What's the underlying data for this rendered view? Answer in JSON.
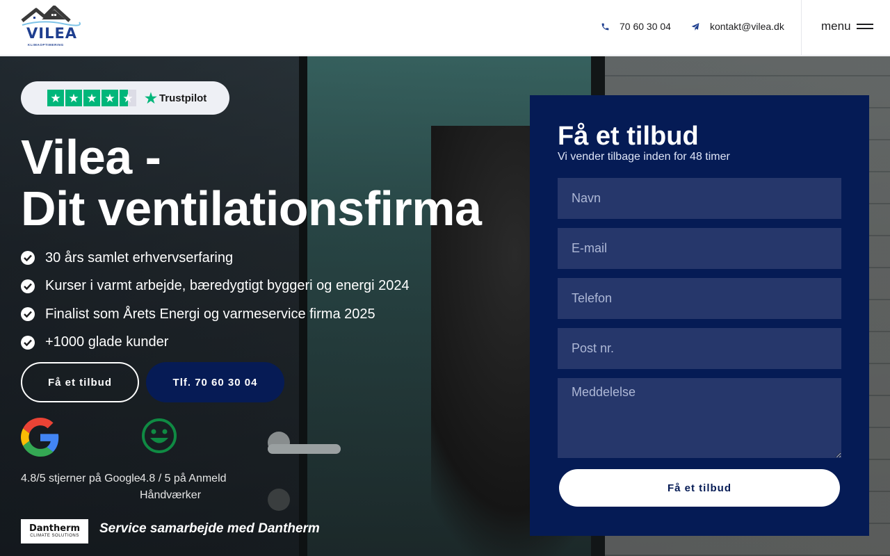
{
  "header": {
    "logo_text": "VILEA",
    "logo_sub": "KLIMAOPTIMERING",
    "phone": "70 60 30 04",
    "email": "kontakt@vilea.dk",
    "menu_label": "menu"
  },
  "hero": {
    "trustpilot": {
      "brand": "Trustpilot",
      "stars": 4.5,
      "star_color": "#00b67a"
    },
    "title_line1": "Vilea -",
    "title_line2": "Dit ventilationsfirma",
    "features": [
      "30 års samlet erhvervserfaring",
      "Kurser i varmt arbejde, bæredygtigt byggeri og energi 2024",
      "Finalist som Årets Energi og varmeservice firma 2025",
      "+1000 glade kunder"
    ],
    "btn_quote": "Få et tilbud",
    "btn_phone": "Tlf. 70 60 30 04",
    "ratings": {
      "google": "4.8/5 stjerner på Google",
      "anmeld": "4.8 / 5 på Anmeld Håndværker"
    },
    "partner": {
      "logo_line1": "Dantherm",
      "logo_line2": "CLIMATE SOLUTIONS",
      "text": "Service samarbejde med Dantherm"
    }
  },
  "form": {
    "title": "Få et tilbud",
    "subtitle": "Vi vender tilbage inden for 48 timer",
    "placeholders": {
      "name": "Navn",
      "email": "E-mail",
      "phone": "Telefon",
      "zip": "Post nr.",
      "message": "Meddelelse"
    },
    "submit": "Få et tilbud"
  },
  "colors": {
    "navy": "#051b55",
    "field": "#26376b",
    "accent_blue": "#1f3f8f"
  }
}
